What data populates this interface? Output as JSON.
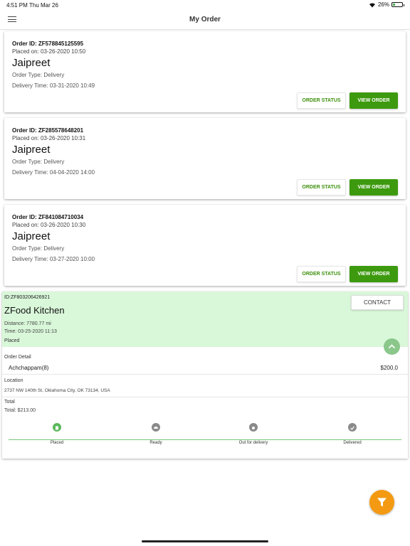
{
  "status_bar": {
    "time": "4:51 PM",
    "date": "Thu Mar 26",
    "battery": "26%"
  },
  "header": {
    "title": "My Order",
    "menu_icon": "hamburger-menu-icon"
  },
  "orders": [
    {
      "id_line": "Order ID: ZF578845125595",
      "placed_line": "Placed on: 03-26-2020 10:50",
      "name": "Jaipreet",
      "type_line": "Order Type: Delivery",
      "delivery_line": "Delivery Time: 03-31-2020 10:49",
      "status_label": "ORDER STATUS",
      "view_label": "VIEW ORDER"
    },
    {
      "id_line": "Order ID: ZF285578648201",
      "placed_line": "Placed on: 03-26-2020 10:31",
      "name": "Jaipreet",
      "type_line": "Order Type: Delivery",
      "delivery_line": "Delivery Time: 04-04-2020 14:00",
      "status_label": "ORDER STATUS",
      "view_label": "VIEW ORDER"
    },
    {
      "id_line": "Order ID: ZF841084710034",
      "placed_line": "Placed on: 03-26-2020 10:30",
      "name": "Jaipreet",
      "type_line": "Order Type: Delivery",
      "delivery_line": "Delivery Time: 03-27-2020 10:00",
      "status_label": "ORDER STATUS",
      "view_label": "VIEW ORDER"
    }
  ],
  "detail": {
    "id_line": "ID:ZF803206426921",
    "kitchen": "ZFood Kitchen",
    "distance_line": "Distance: 7780.77 mi",
    "time_line": "Time: 03-25-2020 11:13",
    "status": "Placed",
    "contact_label": "CONTACT",
    "order_detail_label": "Order Detail",
    "item_name": "Achchappam(8)",
    "item_price": "$200.0",
    "location_label": "Location",
    "address": "2737 NW 140th St, Oklahoma City, OK 73134, USA",
    "total_label": "Total",
    "total_value": "Total: $213.00",
    "steps": [
      "Placed",
      "Ready",
      "Out for delivery",
      "Delivered"
    ]
  },
  "colors": {
    "accent_green": "#3d9a0f",
    "detail_bg": "#d9f7d9",
    "fab_orange": "#f39a12",
    "step_active": "#5cb85c",
    "step_inactive": "#8a8a8a"
  },
  "battery_level": 0.26
}
